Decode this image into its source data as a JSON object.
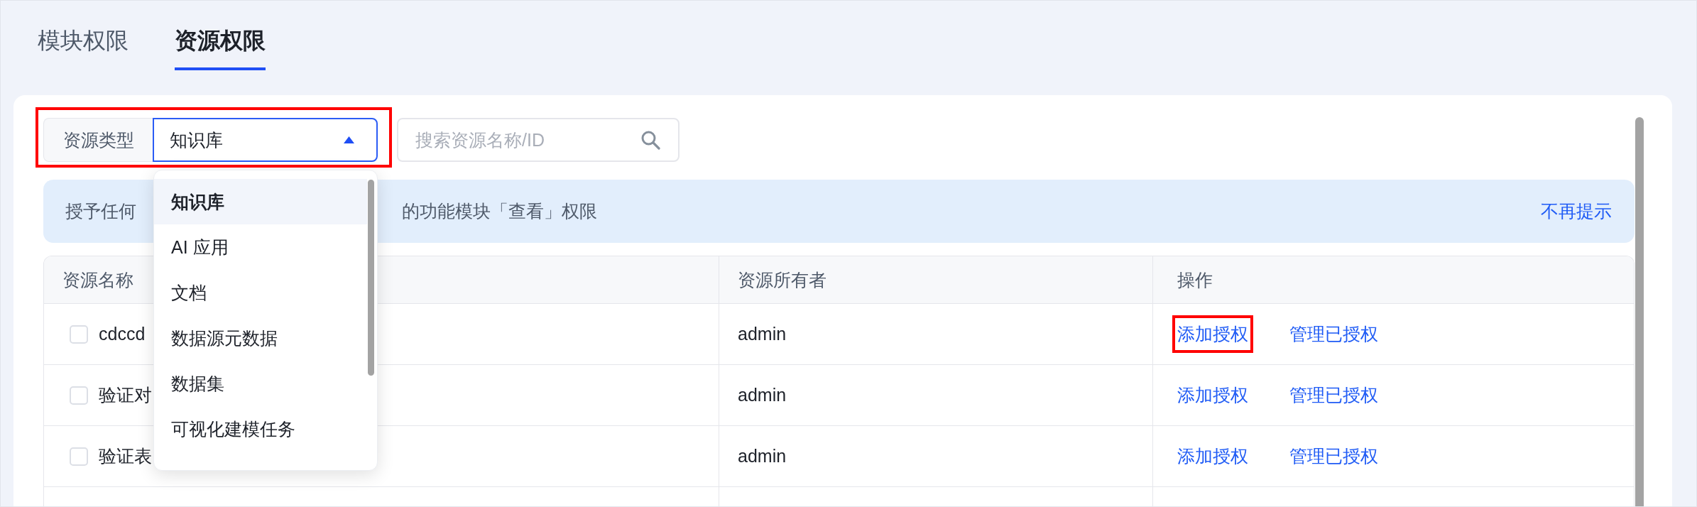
{
  "tabs": [
    {
      "label": "模块权限",
      "selected": false
    },
    {
      "label": "资源权限",
      "selected": true
    }
  ],
  "filter": {
    "label": "资源类型",
    "value": "知识库",
    "expanded": true,
    "highlighted": true,
    "options": [
      {
        "label": "知识库",
        "selected": true
      },
      {
        "label": "AI 应用",
        "selected": false
      },
      {
        "label": "文档",
        "selected": false
      },
      {
        "label": "数据源元数据",
        "selected": false
      },
      {
        "label": "数据集",
        "selected": false
      },
      {
        "label": "可视化建模任务",
        "selected": false
      }
    ]
  },
  "search": {
    "placeholder": "搜索资源名称/ID"
  },
  "notice": {
    "text_fragments": [
      "授予任何",
      "的功能模块「查看」权限"
    ],
    "dismiss": "不再提示"
  },
  "table": {
    "columns": [
      "资源名称",
      "资源所有者",
      "操作"
    ],
    "rows": [
      {
        "name": "cdccd",
        "checked": false,
        "owner": "admin",
        "actions": [
          {
            "label": "添加授权",
            "highlighted": true
          },
          {
            "label": "管理已授权",
            "highlighted": false
          }
        ]
      },
      {
        "name": "验证对",
        "checked": false,
        "owner": "admin",
        "actions": [
          {
            "label": "添加授权",
            "highlighted": false
          },
          {
            "label": "管理已授权",
            "highlighted": false
          }
        ]
      },
      {
        "name": "验证表",
        "checked": false,
        "owner": "admin",
        "actions": [
          {
            "label": "添加授权",
            "highlighted": false
          },
          {
            "label": "管理已授权",
            "highlighted": false
          }
        ]
      }
    ]
  }
}
